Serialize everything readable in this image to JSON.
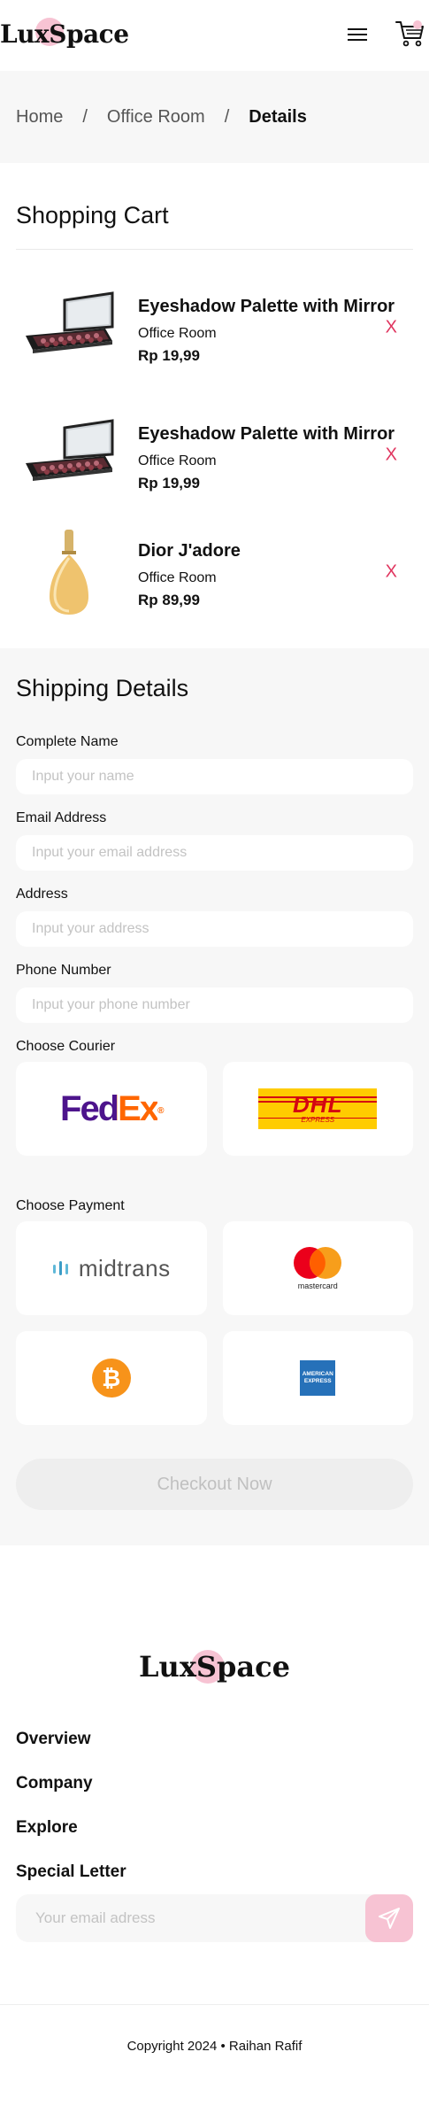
{
  "header": {
    "logo": "LuxSpace",
    "menu_icon": "hamburger-icon",
    "cart_icon": "cart-icon"
  },
  "breadcrumb": {
    "items": [
      "Home",
      "Office Room"
    ],
    "separator": "/",
    "current": "Details"
  },
  "cart": {
    "title": "Shopping Cart",
    "items": [
      {
        "name": "Eyeshadow Palette with Mirror",
        "category": "Office Room",
        "price": "Rp 19,99",
        "remove": "X",
        "image": "eyeshadow-palette"
      },
      {
        "name": "Eyeshadow Palette with Mirror",
        "category": "Office Room",
        "price": "Rp 19,99",
        "remove": "X",
        "image": "eyeshadow-palette"
      },
      {
        "name": "Dior J'adore",
        "category": "Office Room",
        "price": "Rp 89,99",
        "remove": "X",
        "image": "perfume-bottle"
      }
    ]
  },
  "shipping": {
    "title": "Shipping Details",
    "name_label": "Complete Name",
    "name_placeholder": "Input your name",
    "email_label": "Email Address",
    "email_placeholder": "Input your email address",
    "address_label": "Address",
    "address_placeholder": "Input your address",
    "phone_label": "Phone Number",
    "phone_placeholder": "Input your phone number",
    "courier_label": "Choose Courier",
    "couriers": [
      "FedEx",
      "DHL"
    ],
    "dhl_express": "EXPRESS",
    "payment_label": "Choose Payment",
    "payments": [
      "midtrans",
      "mastercard",
      "bitcoin",
      "amex"
    ],
    "mastercard_label": "mastercard",
    "amex_lines": [
      "AMERICAN",
      "EXPRESS"
    ],
    "checkout_label": "Checkout Now"
  },
  "footer": {
    "logo": "LuxSpace",
    "nav": [
      "Overview",
      "Company",
      "Explore",
      "Special Letter"
    ],
    "newsletter_placeholder": "Your email adress",
    "copyright": "Copyright 2024 • Raihan Rafif"
  },
  "colors": {
    "accent_pink": "#f7c3d3",
    "remove_red": "#e0355f",
    "fedex_purple": "#4d148c",
    "fedex_orange": "#ff6600",
    "dhl_yellow": "#ffcc00",
    "dhl_red": "#d40511"
  }
}
